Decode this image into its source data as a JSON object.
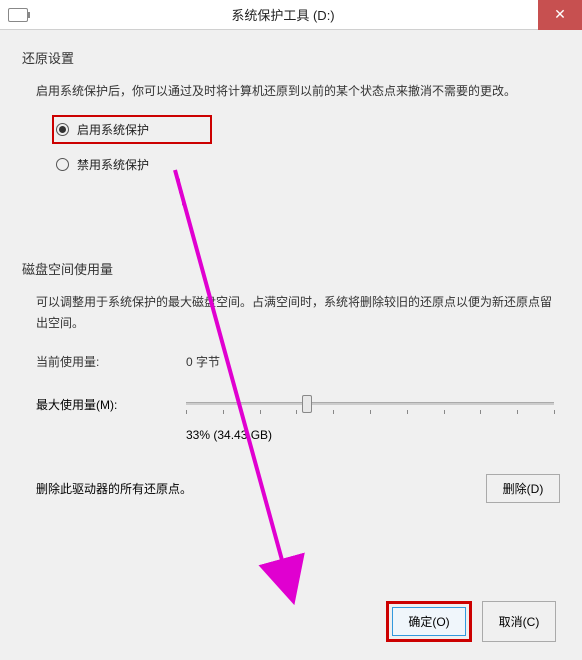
{
  "titlebar": {
    "title": "系统保护工具 (D:)"
  },
  "restore": {
    "section_title": "还原设置",
    "description": "启用系统保护后，你可以通过及时将计算机还原到以前的某个状态点来撤消不需要的更改。",
    "option_enable": "启用系统保护",
    "option_disable": "禁用系统保护"
  },
  "disk": {
    "section_title": "磁盘空间使用量",
    "description": "可以调整用于系统保护的最大磁盘空间。占满空间时，系统将删除较旧的还原点以便为新还原点留出空间。",
    "current_label": "当前使用量:",
    "current_value": "0 字节",
    "max_label": "最大使用量(M):",
    "slider_percent": 33,
    "slider_text": "33% (34.43 GB)",
    "delete_text": "删除此驱动器的所有还原点。",
    "delete_button": "删除(D)"
  },
  "footer": {
    "ok": "确定(O)",
    "cancel": "取消(C)"
  }
}
